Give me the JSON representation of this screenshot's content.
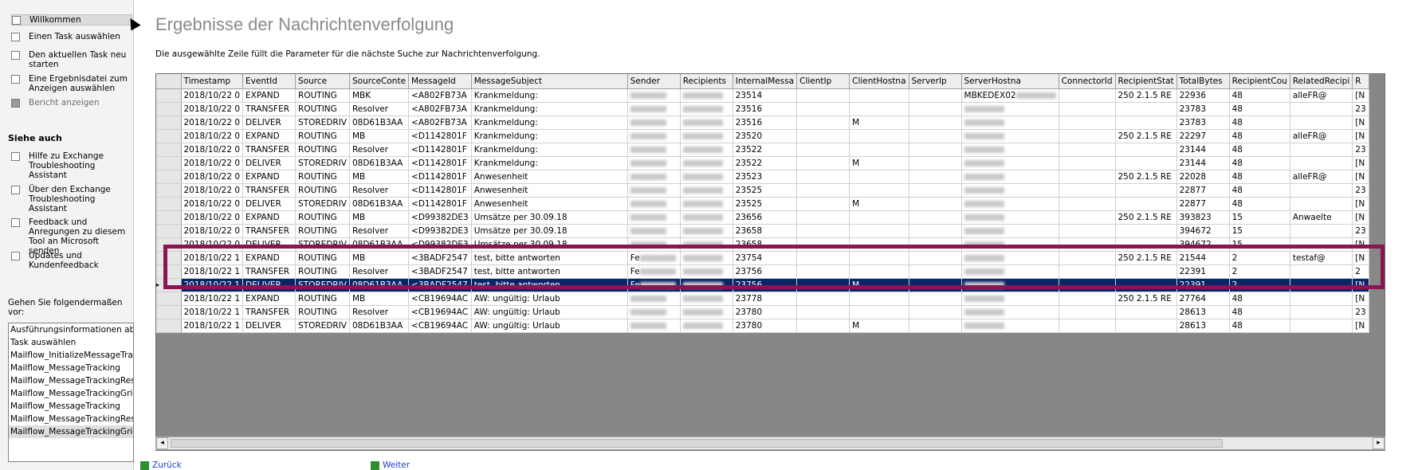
{
  "sidebar": {
    "tasks": [
      {
        "label": "Willkommen",
        "state": "selected"
      },
      {
        "label": "Einen Task auswählen",
        "state": "normal"
      },
      {
        "label": "Den aktuellen Task neu starten",
        "state": "normal"
      },
      {
        "label": "Eine Ergebnisdatei zum Anzeigen auswählen",
        "state": "normal"
      },
      {
        "label": "Bericht anzeigen",
        "state": "disabled"
      }
    ],
    "see_also_heading": "Siehe auch",
    "see_also": [
      {
        "label": "Hilfe zu Exchange Troubleshooting Assistant"
      },
      {
        "label": "Über den Exchange Troubleshooting Assistant"
      },
      {
        "label": "Feedback und Anregungen zu diesem Tool an Microsoft senden"
      },
      {
        "label": "Updates und Kundenfeedback"
      }
    ],
    "procedure_label": "Gehen Sie folgendermaßen vor:",
    "steps": [
      "Ausführungsinformationen abrufe",
      "Task auswählen",
      "Mailflow_InitializeMessageTrackin",
      "Mailflow_MessageTracking",
      "Mailflow_MessageTrackingResul",
      "Mailflow_MessageTrackingGrid",
      "Mailflow_MessageTracking",
      "Mailflow_MessageTrackingResul",
      "Mailflow_MessageTrackingGrid"
    ]
  },
  "main": {
    "title": "Ergebnisse der Nachrichtenverfolgung",
    "subtitle": "Die ausgewählte Zeile füllt die Parameter für die nächste Suche zur Nachrichtenverfolgung.",
    "columns": [
      "Timestamp",
      "EventId",
      "Source",
      "SourceConte",
      "MessageId",
      "MessageSubject",
      "Sender",
      "Recipients",
      "InternalMessa",
      "ClientIp",
      "ClientHostna",
      "ServerIp",
      "ServerHostna",
      "ConnectorId",
      "RecipientStat",
      "TotalBytes",
      "RecipientCou",
      "RelatedRecipi",
      "R"
    ],
    "rows": [
      [
        "2018/10/22 0",
        "EXPAND",
        "ROUTING",
        "MBK",
        "<A802FB73A",
        "Krankmeldung:",
        "",
        "",
        "23514",
        "",
        "",
        "",
        "MBKEDEX02",
        "",
        "250 2.1.5 RE",
        "22936",
        "48",
        "alleFR@",
        "[N"
      ],
      [
        "2018/10/22 0",
        "TRANSFER",
        "ROUTING",
        "Resolver",
        "<A802FB73A",
        "Krankmeldung:",
        "",
        "",
        "23516",
        "",
        "",
        "",
        "",
        "",
        "",
        "23783",
        "48",
        "",
        "23"
      ],
      [
        "2018/10/22 0",
        "DELIVER",
        "STOREDRIV",
        "08D61B3AA",
        "<A802FB73A",
        "Krankmeldung:",
        "",
        "",
        "23516",
        "",
        "M",
        "",
        "",
        "",
        "",
        "23783",
        "48",
        "",
        "[N"
      ],
      [
        "2018/10/22 0",
        "EXPAND",
        "ROUTING",
        "MB",
        "<D1142801F",
        "Krankmeldung:",
        "",
        "",
        "23520",
        "",
        "",
        "",
        "",
        "",
        "250 2.1.5 RE",
        "22297",
        "48",
        "alleFR@",
        "[N"
      ],
      [
        "2018/10/22 0",
        "TRANSFER",
        "ROUTING",
        "Resolver",
        "<D1142801F",
        "Krankmeldung:",
        "",
        "",
        "23522",
        "",
        "",
        "",
        "",
        "",
        "",
        "23144",
        "48",
        "",
        "23"
      ],
      [
        "2018/10/22 0",
        "DELIVER",
        "STOREDRIV",
        "08D61B3AA",
        "<D1142801F",
        "Krankmeldung:",
        "",
        "",
        "23522",
        "",
        "M",
        "",
        "",
        "",
        "",
        "23144",
        "48",
        "",
        "[N"
      ],
      [
        "2018/10/22 0",
        "EXPAND",
        "ROUTING",
        "MB",
        "<D1142801F",
        "Anwesenheit",
        "",
        "",
        "23523",
        "",
        "",
        "",
        "",
        "",
        "250 2.1.5 RE",
        "22028",
        "48",
        "alleFR@",
        "[N"
      ],
      [
        "2018/10/22 0",
        "TRANSFER",
        "ROUTING",
        "Resolver",
        "<D1142801F",
        "Anwesenheit",
        "",
        "",
        "23525",
        "",
        "",
        "",
        "",
        "",
        "",
        "22877",
        "48",
        "",
        "23"
      ],
      [
        "2018/10/22 0",
        "DELIVER",
        "STOREDRIV",
        "08D61B3AA",
        "<D1142801F",
        "Anwesenheit",
        "",
        "",
        "23525",
        "",
        "M",
        "",
        "",
        "",
        "",
        "22877",
        "48",
        "",
        "[N"
      ],
      [
        "2018/10/22 0",
        "EXPAND",
        "ROUTING",
        "MB",
        "<D99382DE3",
        "Umsätze per 30.09.18",
        "",
        "",
        "23656",
        "",
        "",
        "",
        "",
        "",
        "250 2.1.5 RE",
        "393823",
        "15",
        "Anwaelte",
        "[N"
      ],
      [
        "2018/10/22 0",
        "TRANSFER",
        "ROUTING",
        "Resolver",
        "<D99382DE3",
        "Umsätze per 30.09.18",
        "",
        "",
        "23658",
        "",
        "",
        "",
        "",
        "",
        "",
        "394672",
        "15",
        "",
        "23"
      ],
      [
        "2018/10/22 0",
        "DELIVER",
        "STOREDRIV",
        "08D61B3AA",
        "<D99382DE3",
        "Umsätze per 30.09.18",
        "",
        "",
        "23658",
        "",
        "",
        "",
        "",
        "",
        "",
        "394672",
        "15",
        "",
        "[N"
      ],
      [
        "2018/10/22 1",
        "EXPAND",
        "ROUTING",
        "MB",
        "<3BADF2547",
        "test, bitte antworten",
        "Fe",
        "",
        "23754",
        "",
        "",
        "",
        "",
        "",
        "250 2.1.5 RE",
        "21544",
        "2",
        "testaf@",
        "[N"
      ],
      [
        "2018/10/22 1",
        "TRANSFER",
        "ROUTING",
        "Resolver",
        "<3BADF2547",
        "test, bitte antworten",
        "Fe",
        "",
        "23756",
        "",
        "",
        "",
        "",
        "",
        "",
        "22391",
        "2",
        "",
        "2"
      ],
      [
        "2018/10/22 1",
        "DELIVER",
        "STOREDRIV",
        "08D61B3AA",
        "<3BADF2547",
        "test, bitte antworten",
        "Fe",
        "",
        "23756",
        "",
        "M",
        "",
        "",
        "",
        "",
        "22391",
        "2",
        "",
        "[N"
      ],
      [
        "2018/10/22 1",
        "EXPAND",
        "ROUTING",
        "MB",
        "<CB19694AC",
        "AW: ungültig: Urlaub",
        "",
        "",
        "23778",
        "",
        "",
        "",
        "",
        "",
        "250 2.1.5 RE",
        "27764",
        "48",
        "",
        "[N"
      ],
      [
        "2018/10/22 1",
        "TRANSFER",
        "ROUTING",
        "Resolver",
        "<CB19694AC",
        "AW: ungültig: Urlaub",
        "",
        "",
        "23780",
        "",
        "",
        "",
        "",
        "",
        "",
        "28613",
        "48",
        "",
        "23"
      ],
      [
        "2018/10/22 1",
        "DELIVER",
        "STOREDRIV",
        "08D61B3AA",
        "<CB19694AC",
        "AW: ungültig: Urlaub",
        "",
        "",
        "23780",
        "",
        "M",
        "",
        "",
        "",
        "",
        "28613",
        "48",
        "",
        "[N"
      ]
    ],
    "selected_row": 14,
    "nav": {
      "back": "Zurück",
      "forward": "Weiter"
    }
  },
  "colors": {
    "selection": "#0a246a",
    "highlight_border": "#8a1553",
    "grid_background": "#878787"
  }
}
